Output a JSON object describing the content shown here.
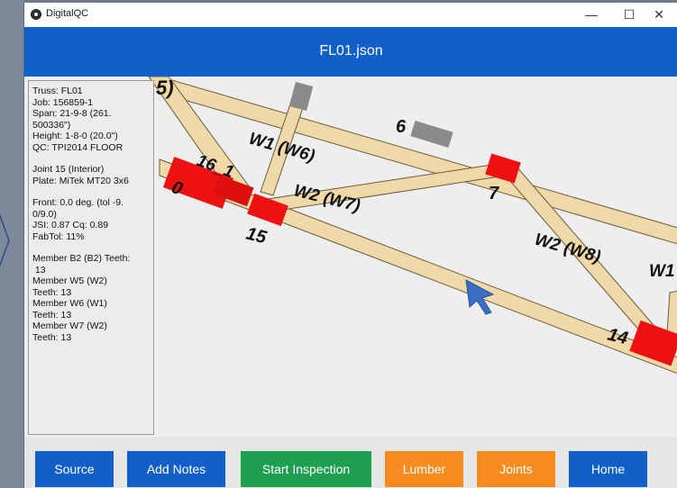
{
  "window": {
    "app_name": "DigitalQC",
    "controls": {
      "minimize": "—",
      "maximize": "☐",
      "close": "✕"
    }
  },
  "header": {
    "title": "FL01.json"
  },
  "info_panel": {
    "truss": "Truss: FL01",
    "job": "Job: 156859-1",
    "span": "Span: 21-9-8 (261.",
    "span_cont": "500336\")",
    "height": "Height: 1-8-0 (20.0\")",
    "qc": "QC: TPI2014 FLOOR",
    "joint": "Joint 15 (Interior)",
    "plate": "Plate: MiTek MT20 3x6",
    "front": "Front: 0.0 deg. (tol -9.",
    "front_cont": "0/9.0)",
    "jsi": "JSI: 0.87 Cq: 0.89",
    "fabtol": "FabTol: 11%",
    "members": [
      {
        "line1": "Member B2 (B2) Teeth:",
        "line2": " 13"
      },
      {
        "line1": "Member W5 (W2)",
        "line2": "Teeth: 13"
      },
      {
        "line1": "Member W6 (W1)",
        "line2": "Teeth: 13"
      },
      {
        "line1": "Member W7 (W2)",
        "line2": "Teeth: 13"
      }
    ]
  },
  "diagram_labels": {
    "w5_partial": "5)",
    "w1": "W1 (W6)",
    "j6": "6",
    "j16": "16_1",
    "j0": "0",
    "w2_w7": "W2 (W7)",
    "j7": "7",
    "j15": "15",
    "w2_w8": "W2 (W8)",
    "w1_partial": "W1",
    "j14": "14"
  },
  "colors": {
    "header": "#1160c9",
    "lumber": "#f0d9a8",
    "plate": "#ee1111",
    "plate_gray": "#8a8a8a",
    "btn_blue": "#1160c9",
    "btn_green": "#1ea050",
    "btn_orange": "#f68b1f"
  },
  "buttons": {
    "source": "Source",
    "add_notes": "Add Notes",
    "start_inspection": "Start Inspection",
    "lumber": "Lumber",
    "joints": "Joints",
    "home": "Home"
  }
}
